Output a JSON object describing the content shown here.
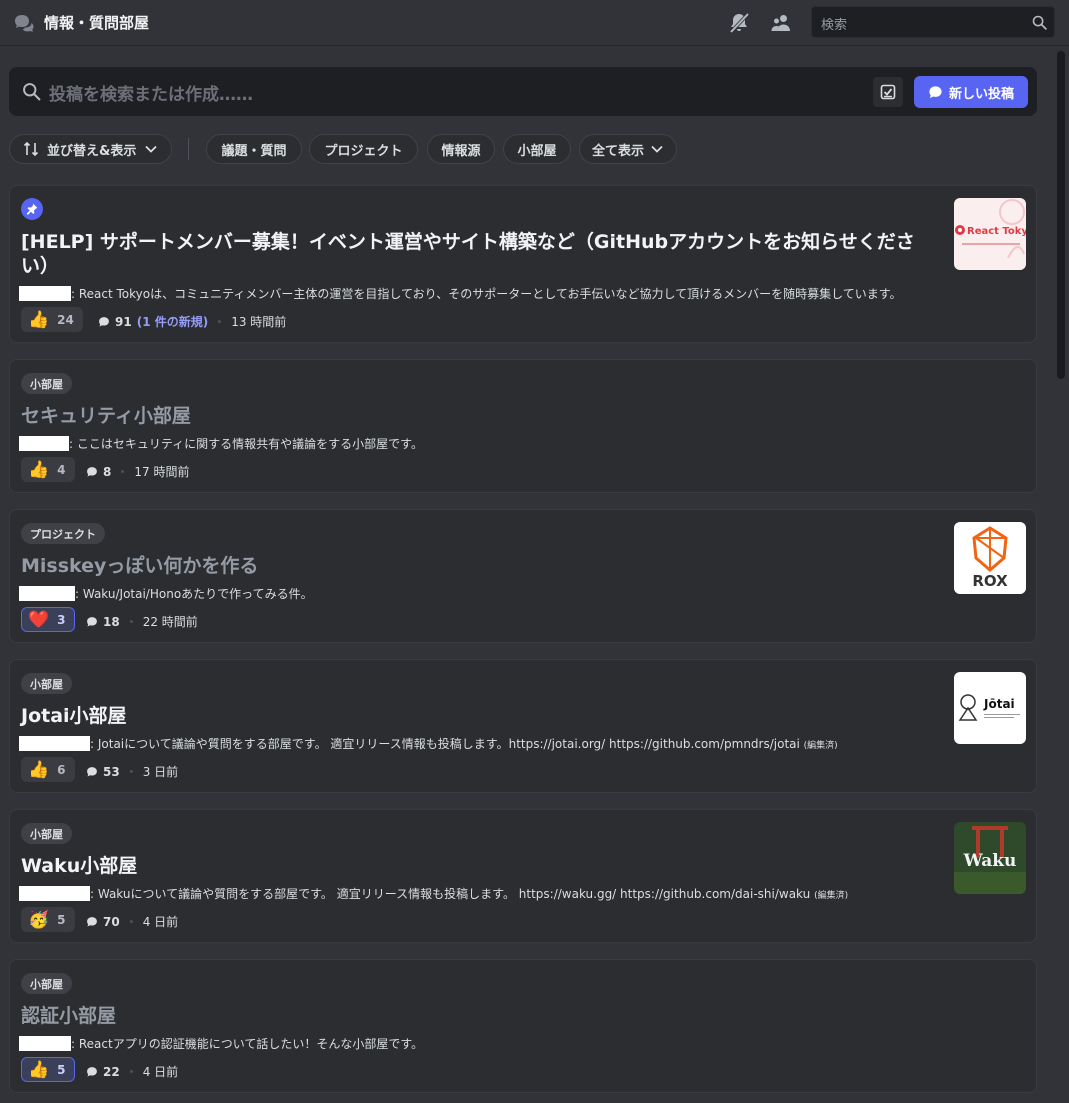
{
  "header": {
    "channel_title": "情報・質問部屋",
    "channel_icon": "forum-channel-icon",
    "mute_icon": "notification-muted-icon",
    "members_icon": "members-icon",
    "search_placeholder": "検索"
  },
  "post_search": {
    "placeholder": "投稿を検索または作成……",
    "new_post_label": "新しい投稿"
  },
  "filters": {
    "sort_label": "並び替え&表示",
    "tags": [
      "議題・質問",
      "プロジェクト",
      "情報源",
      "小部屋"
    ],
    "show_all_label": "全て表示"
  },
  "posts": [
    {
      "pinned": true,
      "tag": "",
      "title": "[HELP] サポートメンバー募集！イベント運営やサイト構築など（GitHubアカウントをお知らせください）",
      "description": ": React Tokyoは、コミュニティメンバー主体の運営を目指しており、そのサポーターとしてお手伝いなど協力して頂けるメンバーを随時募集しています。",
      "edited": "",
      "reaction_emoji": "👍",
      "reaction_count": "24",
      "reaction_mine": false,
      "comments": "91",
      "new_comments": "(1 件の新規)",
      "time": "13 時間前",
      "thumbnail": "React Tokyo",
      "read": false
    },
    {
      "pinned": false,
      "tag": "小部屋",
      "title": "セキュリティ小部屋",
      "description": ": ここはセキュリティに関する情報共有や議論をする小部屋です。",
      "edited": "",
      "reaction_emoji": "👍",
      "reaction_count": "4",
      "reaction_mine": false,
      "comments": "8",
      "new_comments": "",
      "time": "17 時間前",
      "thumbnail": "",
      "read": true
    },
    {
      "pinned": false,
      "tag": "プロジェクト",
      "title": "Misskeyっぽい何かを作る",
      "description": ": Waku/Jotai/Honoあたりで作ってみる件。",
      "edited": "",
      "reaction_emoji": "❤️",
      "reaction_count": "3",
      "reaction_mine": true,
      "comments": "18",
      "new_comments": "",
      "time": "22 時間前",
      "thumbnail": "ROX",
      "read": true
    },
    {
      "pinned": false,
      "tag": "小部屋",
      "title": "Jotai小部屋",
      "description": ": Jotaiについて議論や質問をする部屋です。 適宜リリース情報も投稿します。https://jotai.org/ https://github.com/pmndrs/jotai",
      "edited": "(編集済)",
      "reaction_emoji": "👍",
      "reaction_count": "6",
      "reaction_mine": false,
      "comments": "53",
      "new_comments": "",
      "time": "3 日前",
      "thumbnail": "Jōtai",
      "read": false
    },
    {
      "pinned": false,
      "tag": "小部屋",
      "title": "Waku小部屋",
      "description": ": Wakuについて議論や質問をする部屋です。 適宜リリース情報も投稿します。 https://waku.gg/ https://github.com/dai-shi/waku",
      "edited": "(編集済)",
      "reaction_emoji": "🥳",
      "reaction_count": "5",
      "reaction_mine": false,
      "comments": "70",
      "new_comments": "",
      "time": "4 日前",
      "thumbnail": "Waku",
      "read": false
    },
    {
      "pinned": false,
      "tag": "小部屋",
      "title": "認証小部屋",
      "description": ": Reactアプリの認証機能について話したい！そんな小部屋です。",
      "edited": "",
      "reaction_emoji": "👍",
      "reaction_count": "5",
      "reaction_mine": true,
      "comments": "22",
      "new_comments": "",
      "time": "4 日前",
      "thumbnail": "",
      "read": true
    }
  ],
  "colors": {
    "background": "#313338",
    "card": "#2b2d31",
    "accent": "#5865f2",
    "new_link": "#949cf7"
  }
}
